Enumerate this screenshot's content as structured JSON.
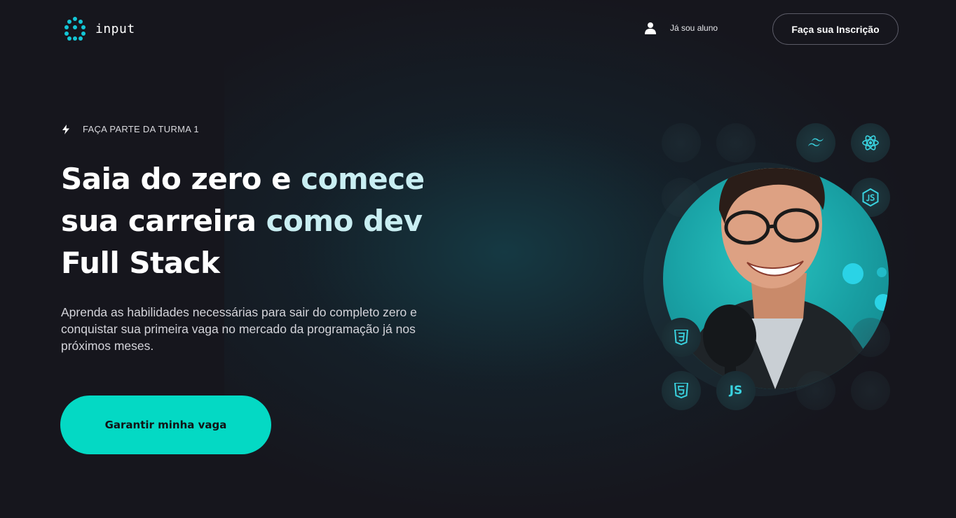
{
  "brand": {
    "name": "input",
    "accent": "#13c6d6",
    "logo_icon": "dotted-circle-logo"
  },
  "header": {
    "student_link": {
      "label": "Já sou aluno",
      "icon": "user-icon"
    },
    "signup_button": "Faça sua Inscrição"
  },
  "hero": {
    "eyebrow": {
      "icon": "lightning-icon",
      "text": "FAÇA PARTE DA TURMA 1"
    },
    "headline": {
      "line1_white": "Saia do zero e ",
      "line1_highlight": "comece",
      "line2_white": "sua carreira ",
      "line2_highlight": "como dev",
      "line3_white": "Full Stack"
    },
    "subtitle": "Aprenda as habilidades necessárias para sair do completo zero e conquistar sua primeira vaga no mercado da programação já nos próximos meses.",
    "cta_label": "Garantir minha vaga",
    "cta_color": "#04d9c4"
  },
  "tech_icons": {
    "js_label": "JS",
    "icons": [
      "tailwind-icon",
      "react-icon",
      "nodejs-icon",
      "css3-icon",
      "html5-icon",
      "javascript-icon"
    ]
  }
}
